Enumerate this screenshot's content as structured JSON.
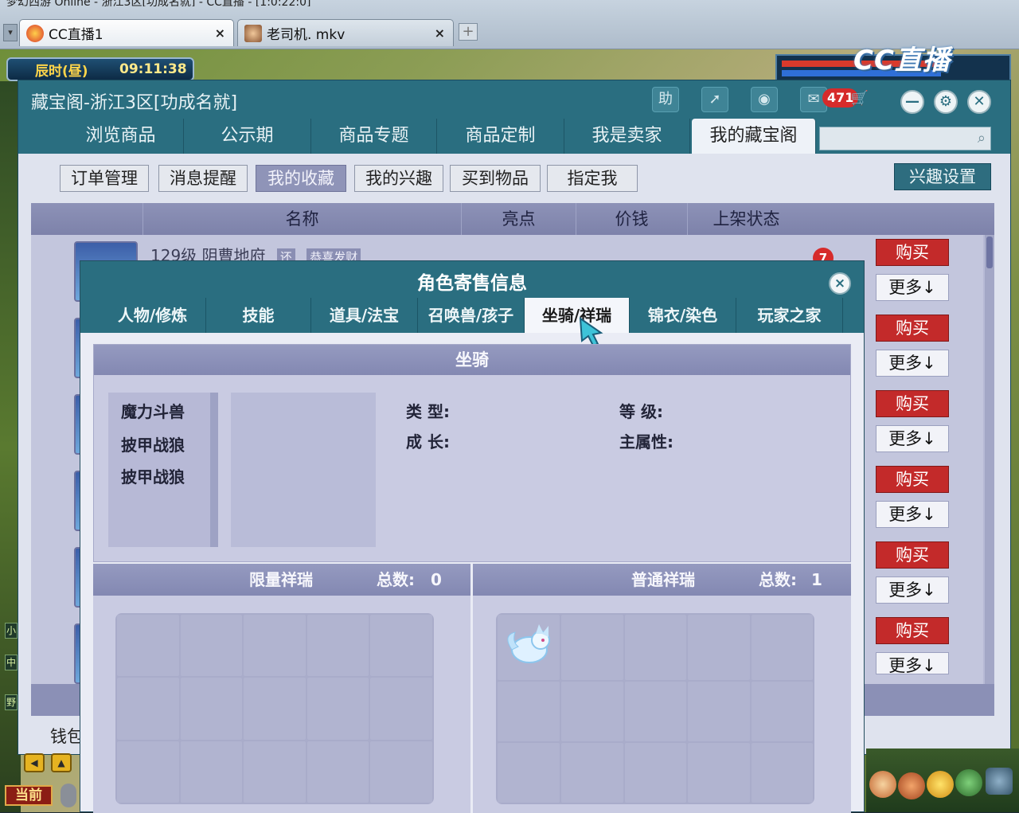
{
  "browser": {
    "caption": "梦幻西游 Online - 浙江3区[功成名就] - CC直播 - [1:0:22:0]",
    "tabs": [
      {
        "label": "CC直播1",
        "close": "×"
      },
      {
        "label": "老司机. mkv",
        "close": "×"
      }
    ],
    "new_tab": "+"
  },
  "game": {
    "time_period": "辰时(昼)",
    "clock": "09:11:38",
    "stream_logo": "CC直播"
  },
  "store": {
    "title": "藏宝阁-浙江3区[功成名就]",
    "toolbar": {
      "help": "助",
      "badge_count": "471"
    },
    "nav_tabs": [
      "浏览商品",
      "公示期",
      "商品专题",
      "商品定制",
      "我是卖家",
      "我的藏宝阁"
    ],
    "search_placeholder": "",
    "sub_buttons": [
      "订单管理",
      "消息提醒",
      "我的收藏",
      "我的兴趣",
      "买到物品",
      "指定我"
    ],
    "interest_settings": "兴趣设置",
    "columns": [
      "名称",
      "亮点",
      "价钱",
      "上架状态"
    ],
    "first_row": {
      "level_name": "129级  阴曹地府",
      "tag1": "还",
      "tag2": "恭喜发财",
      "count_badge": "7"
    },
    "buy_label": "购买",
    "more_label": "更多↓",
    "wallet_label": "钱包"
  },
  "popup": {
    "title": "角色寄售信息",
    "close": "×",
    "tabs": [
      "人物/修炼",
      "技能",
      "道具/法宝",
      "召唤兽/孩子",
      "坐骑/祥瑞",
      "锦衣/染色",
      "玩家之家"
    ],
    "active_tab_index": 4,
    "mount_section": {
      "header": "坐骑",
      "mounts": [
        "魔力斗兽",
        "披甲战狼",
        "披甲战狼"
      ],
      "attr_type": "类    型:",
      "attr_growth": "成    长:",
      "attr_level": "等    级:",
      "attr_main": "主属性:"
    },
    "limited_ruyi": {
      "label": "限量祥瑞",
      "total_label": "总数:",
      "total": "0"
    },
    "normal_ruyi": {
      "label": "普通祥瑞",
      "total_label": "总数:",
      "total": "1"
    }
  },
  "hud": {
    "now_label": "当前"
  },
  "colors": {
    "teal_header": "#2a6e80",
    "buy_red": "#c32a2a",
    "panel_lavender": "#c9cbe2",
    "badge_red": "#d62b2b"
  },
  "icons": [
    "browser-favicon",
    "search-icon",
    "close-icon",
    "minimize-icon",
    "settings-icon",
    "cart-icon",
    "chat-icon",
    "share-icon",
    "record-icon",
    "fox-pet-icon"
  ]
}
